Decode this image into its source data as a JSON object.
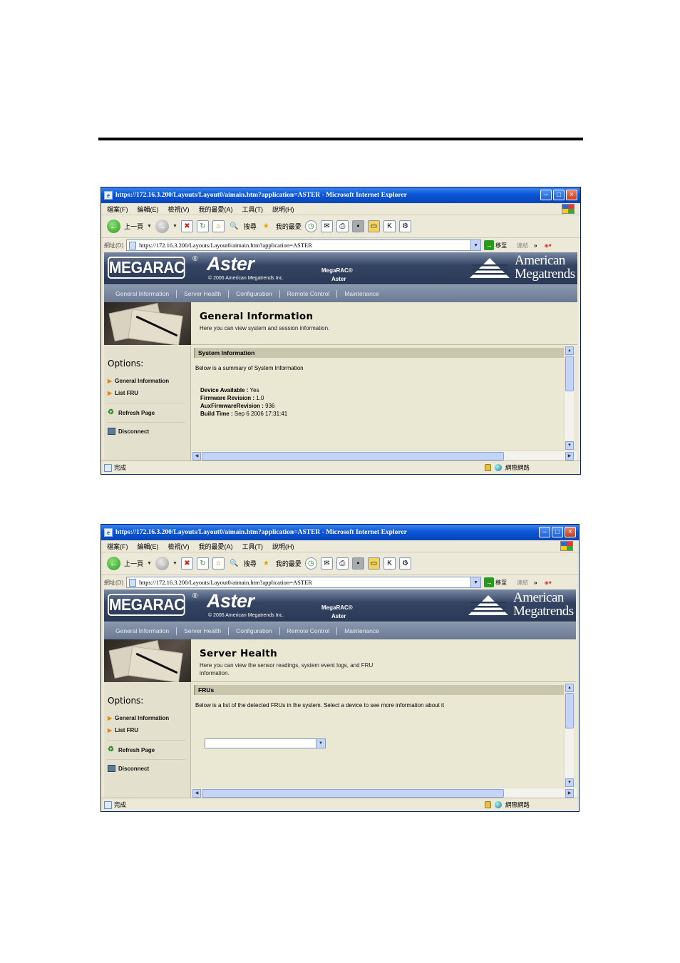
{
  "browser": {
    "title": "https://172.16.3.200/Layouts/Layout0/aimain.htm?application=ASTER - Microsoft Internet Explorer",
    "menu": [
      "檔案(F)",
      "編輯(E)",
      "檢視(V)",
      "我的最愛(A)",
      "工具(T)",
      "說明(H)"
    ],
    "toolbar": {
      "back": "上一頁",
      "search": "搜尋",
      "favorites": "我的最愛"
    },
    "address_label": "網址(D)",
    "url": "https://172.16.3.200/Layouts/Layout0/aimain.htm?application=ASTER",
    "go": "移至",
    "links": "連結",
    "status": "完成",
    "zone": "網際網路"
  },
  "banner": {
    "logo": "MEGARAC",
    "reg": "®",
    "product_title": "Aster",
    "copyright": "© 2006 American Megatrends Inc.",
    "product_line1": "MegaRAC®",
    "product_line2": "Aster",
    "company_line1": "American",
    "company_line2": "Megatrends"
  },
  "nav": [
    "General Information",
    "Server Health",
    "Configuration",
    "Remote Control",
    "Maintenance"
  ],
  "sidebar": {
    "title": "Options:",
    "links": [
      "General Information",
      "List FRU",
      "Refresh Page",
      "Disconnect"
    ]
  },
  "screen1": {
    "header_title": "General Information",
    "header_desc": "Here you can view system and session information.",
    "section_title": "System Information",
    "section_desc": "Below is a summary of System Information",
    "fields": [
      {
        "label": "Device Available :",
        "value": " Yes"
      },
      {
        "label": "Firmware Revision :",
        "value": " 1.0"
      },
      {
        "label": "AuxFirmwareRevision :",
        "value": " 936"
      },
      {
        "label": "Build Time :",
        "value": " Sep 6 2006 17:31:41"
      }
    ]
  },
  "screen2": {
    "header_title": "Server Health",
    "header_desc": "Here you can view the sensor readings, system event logs, and FRU information.",
    "section_title": "FRUs",
    "section_desc": "Below is a list of the detected FRUs in the system. Select a device to see more information about it",
    "select_value": ""
  }
}
